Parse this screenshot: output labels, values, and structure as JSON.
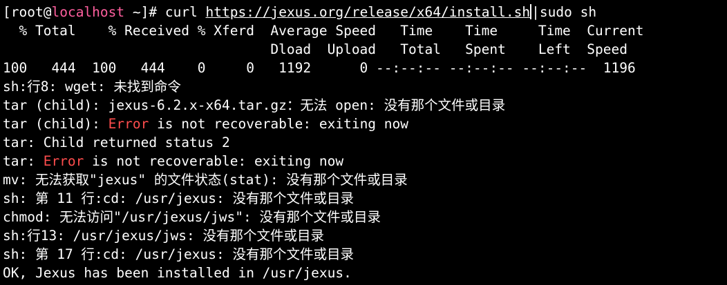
{
  "prompt": {
    "open": "[",
    "user": "root",
    "at": "@",
    "host": "localhost",
    "path_close": " ~]# ",
    "command": "curl ",
    "url": "https://jexus.org/release/x64/install.sh",
    "pipe": "|sudo sh"
  },
  "progress": {
    "header1": "  % Total    % Received % Xferd  Average Speed   Time    Time     Time  Current",
    "header2": "                                 Dload  Upload   Total   Spent    Left  Speed",
    "row": "100   444  100   444    0     0   1192      0 --:--:-- --:--:-- --:--:--  1196"
  },
  "output": {
    "l1": "sh:行8: wget: 未找到命令",
    "l2": "tar (child): jexus-6.2.x-x64.tar.gz：无法 open: 没有那个文件或目录",
    "l3_pre": "tar (child): ",
    "l3_err": "Error",
    "l3_post": " is not recoverable: exiting now",
    "l4": "tar: Child returned status 2",
    "l5_pre": "tar: ",
    "l5_err": "Error",
    "l5_post": " is not recoverable: exiting now",
    "l6": "mv: 无法获取\"jexus\" 的文件状态(stat): 没有那个文件或目录",
    "l7": "sh: 第 11 行:cd: /usr/jexus: 没有那个文件或目录",
    "l8": "chmod: 无法访问\"/usr/jexus/jws\": 没有那个文件或目录",
    "l9": "sh:行13: /usr/jexus/jws: 没有那个文件或目录",
    "l10": "sh: 第 17 行:cd: /usr/jexus: 没有那个文件或目录",
    "l11": "OK, Jexus has been installed in /usr/jexus."
  },
  "colors": {
    "background": "#000000",
    "text": "#ffffff",
    "hostname": "#ff5f9e",
    "error": "#ff4d4d"
  }
}
